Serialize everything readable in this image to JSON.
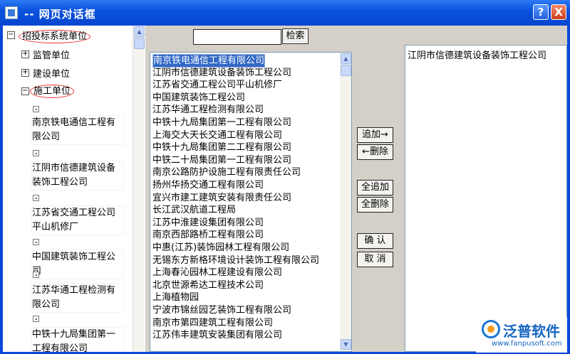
{
  "window": {
    "title": "-- 网页对话框",
    "help_label": "?",
    "close_label": "X"
  },
  "tree": {
    "root": "招投标系统单位",
    "nodes": [
      "监管单位",
      "建设单位",
      "施工单位"
    ],
    "expanders": {
      "root": "−",
      "collapsed": "+",
      "expanded": "−"
    },
    "leaves": [
      "南京铁电通信工程有限公司",
      "江阴市信德建筑设备装饰工程公司",
      "江苏省交通工程公司平山机修厂",
      "中国建筑装饰工程公司",
      "江苏华通工程检测有限公司",
      "中铁十九局集团第一工程有限公司"
    ]
  },
  "search": {
    "value": "",
    "button_label": "检索"
  },
  "list": {
    "items": [
      "南京铁电通信工程有限公司",
      "江阴市信德建筑设备装饰工程公司",
      "江苏省交通工程公司平山机修厂",
      "中国建筑装饰工程公司",
      "江苏华通工程检测有限公司",
      "中铁十九局集团第一工程有限公司",
      "上海交大天长交通工程有限公司",
      "中铁十九局集团第二工程有限公司",
      "中铁二十局集团第一工程有限公司",
      "南京公路防护设施工程有限责任公司",
      "扬州华扬交通工程有限公司",
      "宜兴市建工建筑安装有限责任公司",
      "长江武汉航道工程局",
      "江苏中淮建设集团有限公司",
      "南京西部路桥工程有限公司",
      "中惠(江苏)装饰园林工程有限公司",
      "无锡东方新格环境设计装饰工程有限公司",
      "上海春沁园林工程建设有限公司",
      "北京世源希达工程技术公司",
      "上海植物园",
      "宁波市锦丝园艺装饰工程有限公司",
      "南京市第四建筑工程有限公司",
      "江苏伟丰建筑安装集团有限公司"
    ],
    "selected_index": 0
  },
  "buttons": {
    "add": "追加→",
    "remove": "←删除",
    "add_all": "全追加",
    "remove_all": "全删除",
    "confirm": "确 认",
    "cancel": "取 消"
  },
  "selected": {
    "items": [
      "江阴市信德建筑设备装饰工程公司"
    ]
  },
  "watermark": {
    "brand": "泛普软件",
    "url": "www.fanpusoft.com"
  },
  "colors": {
    "titlebar": "#0a52de",
    "selection": "#3169c6",
    "highlight_oval": "#e33333"
  }
}
